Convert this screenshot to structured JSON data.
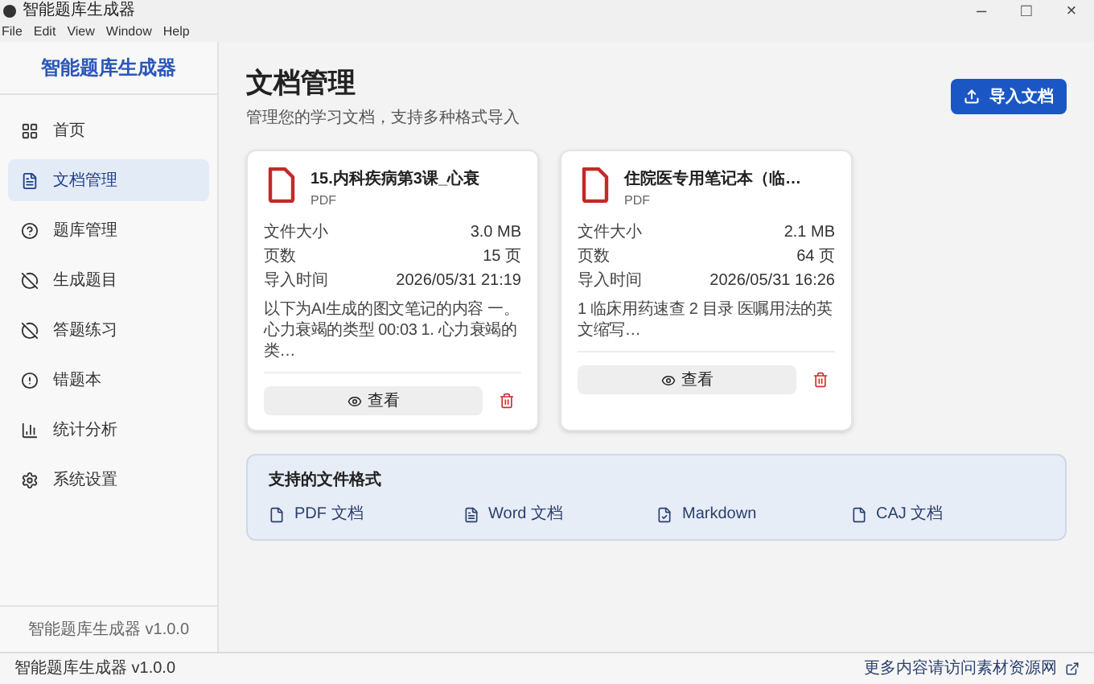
{
  "window": {
    "title": "智能题库生成器",
    "controls": [
      "–",
      "□",
      "×"
    ]
  },
  "menu": [
    "File",
    "Edit",
    "View",
    "Window",
    "Help"
  ],
  "sidebar": {
    "brand": "智能题库生成器",
    "items": [
      {
        "label": "首页",
        "selected": false
      },
      {
        "label": "文档管理",
        "selected": true
      },
      {
        "label": "题库管理",
        "selected": false
      },
      {
        "label": "生成题目",
        "selected": false
      },
      {
        "label": "答题练习",
        "selected": false
      },
      {
        "label": "错题本",
        "selected": false
      },
      {
        "label": "统计分析",
        "selected": false
      },
      {
        "label": "系统设置",
        "selected": false
      }
    ],
    "footer": "智能题库生成器 v1.0.0"
  },
  "page": {
    "title": "文档管理",
    "subtitle": "管理您的学习文档，支持多种格式导入",
    "import_button": "导入文档"
  },
  "documents": [
    {
      "name": "15.内科疾病第3课_心衰",
      "type": "PDF",
      "fields": [
        {
          "label": "文件大小",
          "value": "3.0 MB"
        },
        {
          "label": "页数",
          "value": "15 页"
        },
        {
          "label": "导入时间",
          "value": "2026/05/31 21:19"
        }
      ],
      "excerpt": "以下为AI生成的图文笔记的内容 一。心力衰竭的类型 00:03 1. 心力衰竭的类…",
      "view_button": "查看"
    },
    {
      "name": "住院医专用笔记本（临…",
      "type": "PDF",
      "fields": [
        {
          "label": "文件大小",
          "value": "2.1 MB"
        },
        {
          "label": "页数",
          "value": "64 页"
        },
        {
          "label": "导入时间",
          "value": "2026/05/31 16:26"
        }
      ],
      "excerpt": "1 临床用药速查 2 目录 医嘱用法的英文缩写…",
      "view_button": "查看"
    }
  ],
  "formats": {
    "title": "支持的文件格式",
    "items": [
      {
        "label": "PDF 文档",
        "kind": "plain"
      },
      {
        "label": "Word 文档",
        "kind": "text"
      },
      {
        "label": "Markdown",
        "kind": "check"
      },
      {
        "label": "CAJ 文档",
        "kind": "plain"
      }
    ]
  },
  "status_bar": {
    "left": "智能题库生成器 v1.0.0",
    "link": "更多内容请访问素材资源网"
  }
}
